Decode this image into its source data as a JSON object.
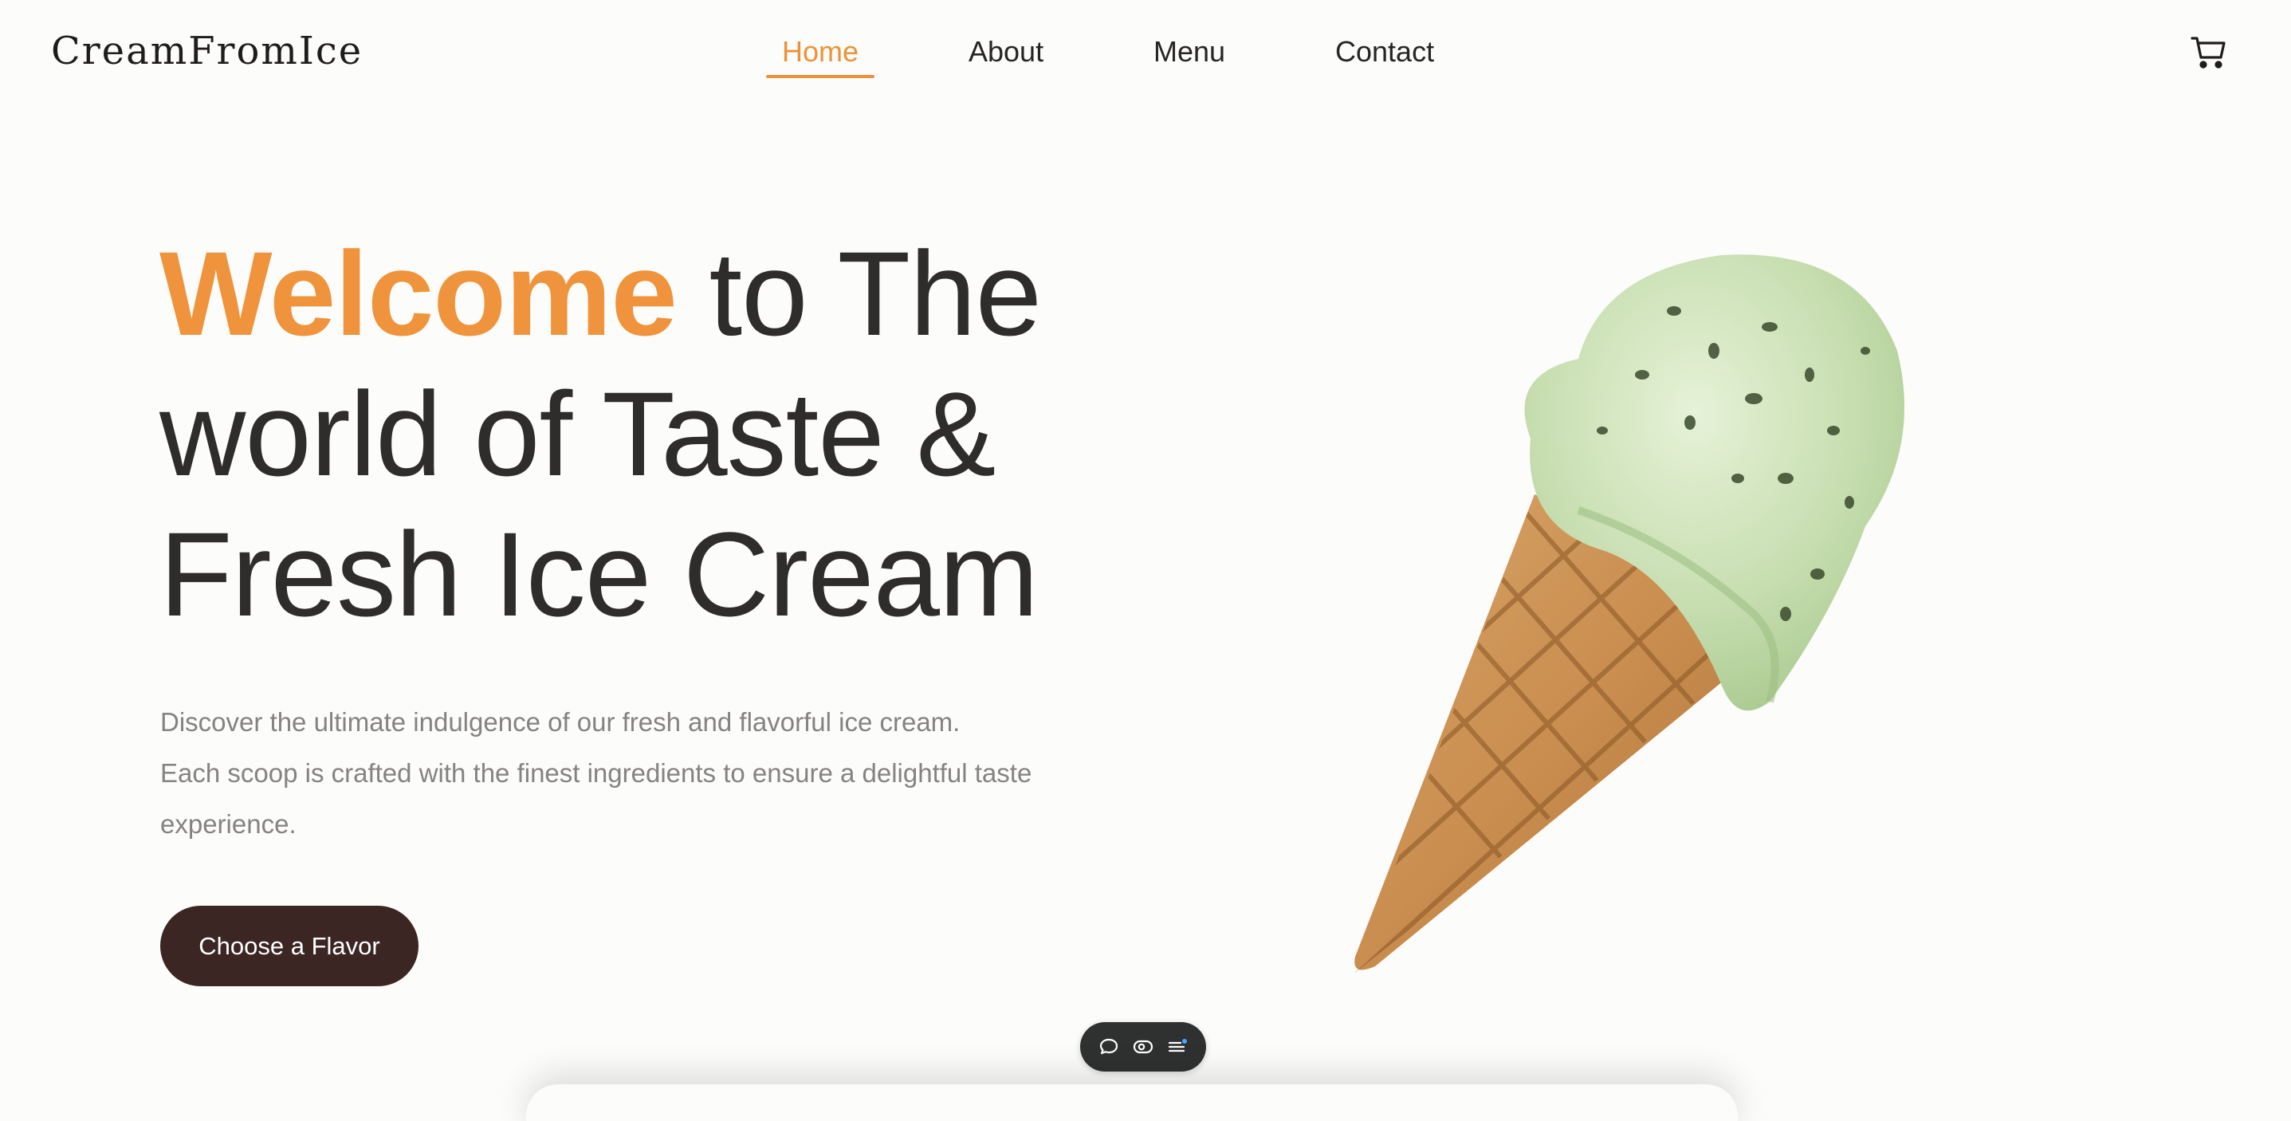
{
  "brand": {
    "logo_text": "CreamFromIce"
  },
  "nav": {
    "items": [
      {
        "label": "Home",
        "active": true
      },
      {
        "label": "About",
        "active": false
      },
      {
        "label": "Menu",
        "active": false
      },
      {
        "label": "Contact",
        "active": false
      }
    ],
    "cart_icon": "cart-icon"
  },
  "hero": {
    "title_accent": "Welcome",
    "title_line1_rest": " to The",
    "title_line2": "world of Taste &",
    "title_line3": "Fresh Ice Cream",
    "description_lines": [
      "Discover the ultimate indulgence of our fresh and flavorful ice cream.",
      "Each scoop is crafted with the finest ingredients to ensure a delightful taste",
      "experience."
    ],
    "cta_label": "Choose a Flavor",
    "image_icon": "ice-cream-cone-image"
  },
  "toolbar": {
    "icons": [
      "comment-icon",
      "eye-icon",
      "list-icon"
    ]
  },
  "colors": {
    "accent": "#ef943c",
    "text_dark": "#2f2d2c",
    "text_muted": "#858381",
    "cta_bg": "#3b2624",
    "background": "#fcfcfa"
  }
}
